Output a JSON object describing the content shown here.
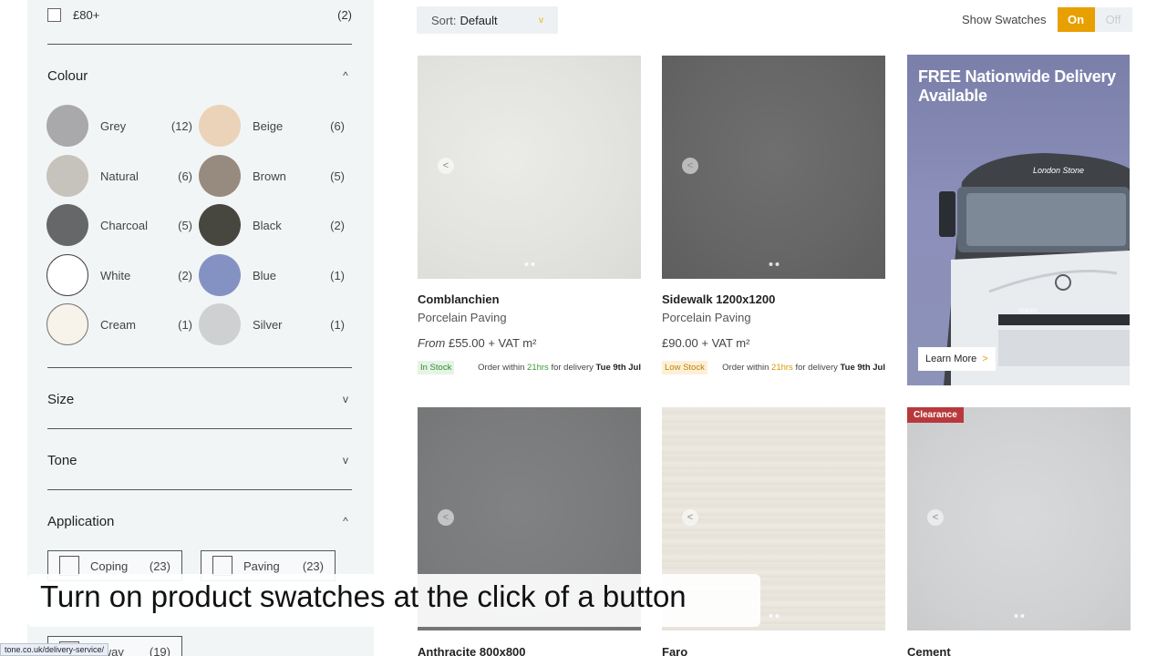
{
  "filters": {
    "price": {
      "label": "£80+",
      "count": "(2)"
    },
    "colour": {
      "title": "Colour",
      "items": [
        {
          "name": "Grey",
          "count": "(12)",
          "color": "#a9a9ab"
        },
        {
          "name": "Beige",
          "count": "(6)",
          "color": "#ead3b8"
        },
        {
          "name": "Natural",
          "count": "(6)",
          "color": "#c6c2bc"
        },
        {
          "name": "Brown",
          "count": "(5)",
          "color": "#978b80"
        },
        {
          "name": "Charcoal",
          "count": "(5)",
          "color": "#656768"
        },
        {
          "name": "Black",
          "count": "(2)",
          "color": "#474740"
        },
        {
          "name": "White",
          "count": "(2)",
          "color": "#ffffff"
        },
        {
          "name": "Blue",
          "count": "(1)",
          "color": "#8492c3"
        },
        {
          "name": "Cream",
          "count": "(1)",
          "color": "#f8f3ea"
        },
        {
          "name": "Silver",
          "count": "(1)",
          "color": "#cfd0d1"
        }
      ]
    },
    "size": {
      "title": "Size"
    },
    "tone": {
      "title": "Tone"
    },
    "application": {
      "title": "Application",
      "items": [
        {
          "label": "Coping",
          "count": "(23)"
        },
        {
          "label": "Paving",
          "count": "(23)"
        },
        {
          "label": "veway",
          "count": "(19)"
        }
      ]
    }
  },
  "toolbar": {
    "sort_label": "Sort:",
    "sort_value": "Default",
    "swatches_label": "Show Swatches",
    "on_label": "On",
    "off_label": "Off"
  },
  "products": [
    {
      "name": "Comblanchien",
      "type": "Porcelain Paving",
      "price_prefix": "From",
      "price": "£55.00 + VAT m²",
      "stock": "In Stock",
      "order_prefix": "Order within",
      "order_hours": "21hrs",
      "order_mid": "for delivery",
      "order_date": "Tue 9th Jul",
      "image_color": "#e3e3e0"
    },
    {
      "name": "Sidewalk 1200x1200",
      "type": "Porcelain Paving",
      "price_prefix": "",
      "price": "£90.00 + VAT m²",
      "stock": "Low Stock",
      "order_prefix": "Order within",
      "order_hours": "21hrs",
      "order_mid": "for delivery",
      "order_date": "Tue 9th Jul",
      "image_color": "#676867"
    },
    {
      "name": "Anthracite 800x800",
      "image_color": "#7a7b7c"
    },
    {
      "name": "Faro",
      "image_color": "#e9e5dc"
    },
    {
      "name": "Cement",
      "image_color": "#d1d2d4",
      "badge": "Clearance"
    }
  ],
  "promo": {
    "title": "FREE Nationwide Delivery Available",
    "truck_brand": "London Stone",
    "truck_make": "VOLVO",
    "cta": "Learn More",
    "cta_arrow": ">"
  },
  "caption": "Turn on product swatches at the click of a button",
  "statusbar_url": "tone.co.uk/delivery-service/",
  "icons": {
    "chevron_up": "^",
    "chevron_down": "v",
    "slide_prev": "<"
  }
}
